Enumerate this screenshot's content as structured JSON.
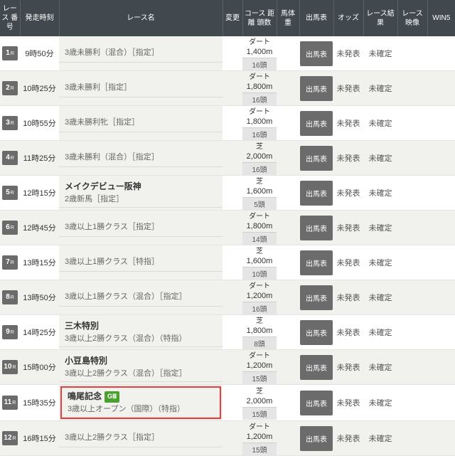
{
  "headers": {
    "no": "レース\n番号",
    "time": "発走時刻",
    "name": "レース名",
    "change": "変更",
    "course": "コース\n距離\n頭数",
    "weight": "馬体重",
    "entry": "出馬表",
    "odds": "オッズ",
    "result": "レース結果",
    "video": "レース映像",
    "win5": "WIN5"
  },
  "ui": {
    "entry_btn": "出馬表",
    "odds_unreleased": "未発表",
    "result_unconfirmed": "未確定"
  },
  "races": [
    {
      "no": "1",
      "time": "9時50分",
      "name": "3歳未勝利（混合）［指定］",
      "surface": "ダート",
      "dist": "1,400m",
      "heads": "16頭"
    },
    {
      "no": "2",
      "time": "10時25分",
      "name": "3歳未勝利［指定］",
      "surface": "ダート",
      "dist": "1,800m",
      "heads": "16頭"
    },
    {
      "no": "3",
      "time": "10時55分",
      "name": "3歳未勝利牝［指定］",
      "surface": "ダート",
      "dist": "1,800m",
      "heads": "16頭"
    },
    {
      "no": "4",
      "time": "11時25分",
      "name": "3歳未勝利（混合）［指定］",
      "surface": "芝",
      "dist": "2,000m",
      "heads": "16頭"
    },
    {
      "no": "5",
      "time": "12時15分",
      "title": "メイクデビュー阪神",
      "name": "2歳新馬［指定］",
      "surface": "芝",
      "dist": "1,600m",
      "heads": "5頭"
    },
    {
      "no": "6",
      "time": "12時45分",
      "name": "3歳以上1勝クラス［指定］",
      "surface": "ダート",
      "dist": "1,800m",
      "heads": "14頭"
    },
    {
      "no": "7",
      "time": "13時15分",
      "name": "3歳以上1勝クラス［特指］",
      "surface": "芝",
      "dist": "1,600m",
      "heads": "10頭"
    },
    {
      "no": "8",
      "time": "13時50分",
      "name": "3歳以上1勝クラス（混合）［指定］",
      "surface": "ダート",
      "dist": "1,200m",
      "heads": "16頭"
    },
    {
      "no": "9",
      "time": "14時25分",
      "title": "三木特別",
      "name": "3歳以上2勝クラス（混合）（特指）",
      "surface": "芝",
      "dist": "1,800m",
      "heads": "8頭"
    },
    {
      "no": "10",
      "time": "15時00分",
      "title": "小豆島特別",
      "name": "3歳以上2勝クラス（混合）［指定］",
      "surface": "ダート",
      "dist": "1,200m",
      "heads": "15頭"
    },
    {
      "no": "11",
      "time": "15時35分",
      "title": "鳴尾記念",
      "grade": "GⅢ",
      "name": "3歳以上オープン（国際）（特指）",
      "surface": "芝",
      "dist": "2,000m",
      "heads": "15頭",
      "highlight": true
    },
    {
      "no": "12",
      "time": "16時15分",
      "name": "3歳以上2勝クラス［指定］",
      "surface": "ダート",
      "dist": "1,200m",
      "heads": "15頭"
    }
  ]
}
